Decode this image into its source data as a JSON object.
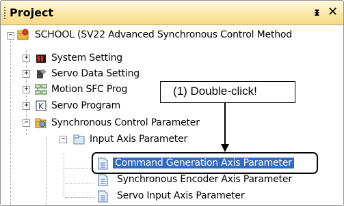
{
  "panel": {
    "title": "Project",
    "pin_icon": "pin-icon",
    "close_icon": "close-icon"
  },
  "tree": {
    "root": "SCHOOL (SV22 Advanced Synchronous Control Method",
    "items": [
      {
        "label": "System Setting",
        "icon": "system-setting-icon"
      },
      {
        "label": "Servo Data Setting",
        "icon": "servo-data-icon"
      },
      {
        "label": "Motion SFC Prog",
        "icon": "motion-sfc-icon"
      },
      {
        "label": "Servo Program",
        "icon": "servo-program-icon"
      },
      {
        "label": "Synchronous Control Parameter",
        "icon": "synchronous-control-icon"
      },
      {
        "label": "Input Axis Parameter",
        "icon": "input-axis-icon"
      },
      {
        "label": "Command Generation Axis Parameter",
        "icon": "document-icon"
      },
      {
        "label": "Synchronous Encoder Axis Parameter",
        "icon": "document-icon"
      },
      {
        "label": "Servo Input Axis Parameter",
        "icon": "document-icon"
      }
    ]
  },
  "callout": {
    "text": "(1) Double-click!"
  }
}
